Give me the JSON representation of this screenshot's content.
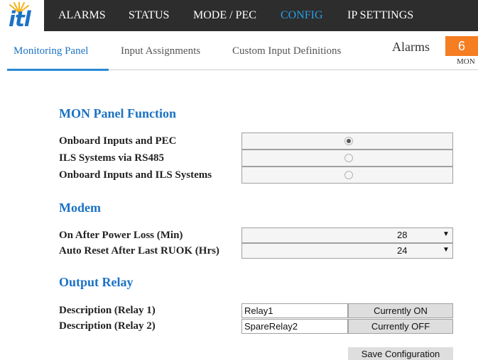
{
  "logo": {
    "text": "itl"
  },
  "nav": {
    "alarms": "ALARMS",
    "status": "STATUS",
    "mode": "MODE / PEC",
    "config": "CONFIG",
    "ip": "IP SETTINGS"
  },
  "tabs": {
    "monitoring": "Monitoring Panel",
    "input": "Input Assignments",
    "custom": "Custom Input Definitions"
  },
  "alarms": {
    "label": "Alarms",
    "count": "6",
    "sublabel": "MON",
    "badge_color": "#f57d22"
  },
  "mon_panel": {
    "title": "MON Panel Function",
    "options": [
      {
        "label": "Onboard Inputs and PEC",
        "checked": true
      },
      {
        "label": "ILS Systems via RS485",
        "checked": false
      },
      {
        "label": "Onboard Inputs and ILS Systems",
        "checked": false
      }
    ]
  },
  "modem": {
    "title": "Modem",
    "fields": [
      {
        "label": "On After Power Loss (Min)",
        "value": "28"
      },
      {
        "label": "Auto Reset After Last RUOK (Hrs)",
        "value": "24"
      }
    ]
  },
  "relay": {
    "title": "Output Relay",
    "rows": [
      {
        "label": "Description (Relay 1)",
        "value": "Relay1",
        "status": "Currently ON"
      },
      {
        "label": "Description (Relay 2)",
        "value": "SpareRelay2",
        "status": "Currently OFF"
      }
    ]
  },
  "save_label": "Save Configuration",
  "colors": {
    "accent": "#1b72c4",
    "nav_bg": "#2d2d2d",
    "nav_active": "#29a0e6"
  }
}
